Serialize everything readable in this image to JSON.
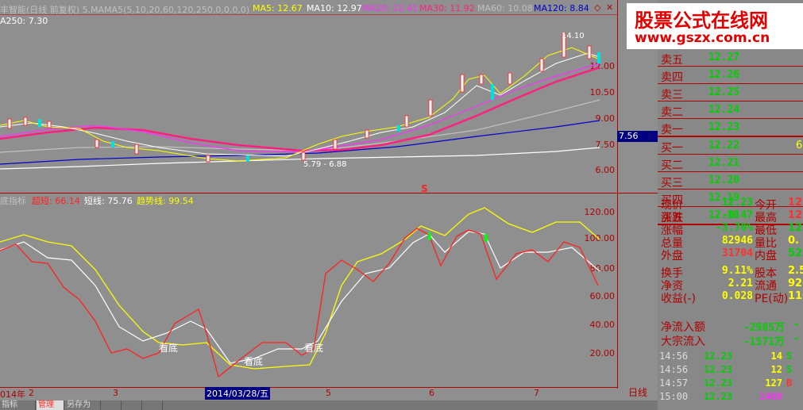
{
  "price_legend": {
    "title": "丰智能(日线 前复权) 5.MAMA5(5,10,20,60,120,250,0,0,0,0)",
    "ma5": "MA5: 12.67",
    "ma10": "MA10: 12.97",
    "ma20": "MA20: 12.41",
    "ma30": "MA30: 11.92",
    "ma60": "MA60: 10.08",
    "ma120": "MA120: 8.84",
    "ma250": "A250: 7.30"
  },
  "price_axis": [
    "12.00",
    "10.50",
    "9.00",
    "7.50",
    "6.00"
  ],
  "price_current_tag": "7.56",
  "price_annotations": {
    "high": "14.10",
    "low_pair": "5.79 - 6.88",
    "s_marker": "S"
  },
  "indicator_legend": {
    "name": "底指标",
    "chaoduan": "超短: 66.14",
    "duanxian": "短线: 75.76",
    "qushi": "趋势线: 99.54"
  },
  "indicator_axis": [
    "120.00",
    "100.00",
    "80.00",
    "60.00",
    "40.00",
    "20.00"
  ],
  "indicator_annotations": [
    "看底",
    "看底",
    "看底"
  ],
  "time_axis": {
    "labels": [
      "014年",
      "2",
      "3",
      "5",
      "6",
      "7"
    ],
    "cursor_date": "2014/03/28/五",
    "right_label": "日线"
  },
  "bottom_tabs": [
    "指标",
    "管理",
    "另存为",
    "",
    "",
    ""
  ],
  "order_book": [
    {
      "label": "卖五",
      "price": "12.27",
      "vol": ""
    },
    {
      "label": "卖四",
      "price": "12.26",
      "vol": ""
    },
    {
      "label": "卖三",
      "price": "12.25",
      "vol": ""
    },
    {
      "label": "卖二",
      "price": "12.24",
      "vol": ""
    },
    {
      "label": "卖一",
      "price": "12.23",
      "vol": ""
    },
    {
      "label": "买一",
      "price": "12.22",
      "vol": "6"
    },
    {
      "label": "买二",
      "price": "12.21",
      "vol": ""
    },
    {
      "label": "买三",
      "price": "12.20",
      "vol": ""
    },
    {
      "label": "买四",
      "price": "12.19",
      "vol": ""
    },
    {
      "label": "买五",
      "price": "12.18",
      "vol": ""
    }
  ],
  "quotes": [
    {
      "l": "现价",
      "v": "12.23",
      "vc": "#00d000",
      "l2": "今开",
      "v2": "12.",
      "v2c": "#ff3030"
    },
    {
      "l": "涨跌",
      "v": "-0.47",
      "vc": "#00d000",
      "l2": "最高",
      "v2": "12.",
      "v2c": "#ff3030"
    },
    {
      "l": "涨幅",
      "v": "-3.70%",
      "vc": "#00d000",
      "l2": "最低",
      "v2": "12.",
      "v2c": "#00d000"
    },
    {
      "l": "总量",
      "v": "82946",
      "vc": "#ffff00",
      "l2": "量比",
      "v2": "0.",
      "v2c": "#ffff00"
    },
    {
      "l": "外盘",
      "v": "31704",
      "vc": "#ff3030",
      "l2": "内盘",
      "v2": "522",
      "v2c": "#00d000"
    },
    {
      "l": "换手",
      "v": "9.11%",
      "vc": "#ffff00",
      "l2": "股本",
      "v2": "2.50",
      "v2c": "#ffff00"
    },
    {
      "l": "净资",
      "v": "2.21",
      "vc": "#ffff00",
      "l2": "流通",
      "v2": "9209",
      "v2c": "#ffff00"
    },
    {
      "l": "收益(-)",
      "v": "0.028",
      "vc": "#ffff00",
      "l2": "PE(动)",
      "v2": "110",
      "v2c": "#ffff00"
    }
  ],
  "flows": [
    {
      "l": "净流入额",
      "v": "-2985万",
      "extra": "-"
    },
    {
      "l": "大宗流入",
      "v": "-1571万",
      "extra": "-"
    }
  ],
  "ticks": [
    {
      "t": "14:56",
      "p": "12.23",
      "v": "14",
      "s": "S",
      "vc": "#ffff00",
      "sc": "#00d000"
    },
    {
      "t": "14:56",
      "p": "12.23",
      "v": "12",
      "s": "S",
      "vc": "#ffff00",
      "sc": "#00d000"
    },
    {
      "t": "14:57",
      "p": "12.23",
      "v": "127",
      "s": "B",
      "vc": "#ffff00",
      "sc": "#ff3030"
    },
    {
      "t": "15:00",
      "p": "12.23",
      "v": "1469",
      "s": "",
      "vc": "#ff30ff",
      "sc": "#00d000"
    }
  ],
  "watermark": {
    "line1": "股票公式在线网",
    "line2": "www.gszx.com.cn"
  },
  "colors": {
    "ma5": "#ffff00",
    "ma10": "#ffffff",
    "ma20": "#ff30ff",
    "ma30": "#ff2080",
    "ma60": "#c0c0c0",
    "ma120": "#0000cc",
    "ma250": "#ffffff",
    "chaoduan": "#ff2020",
    "duanxian": "#ffffff",
    "qushi": "#ffff00"
  }
}
